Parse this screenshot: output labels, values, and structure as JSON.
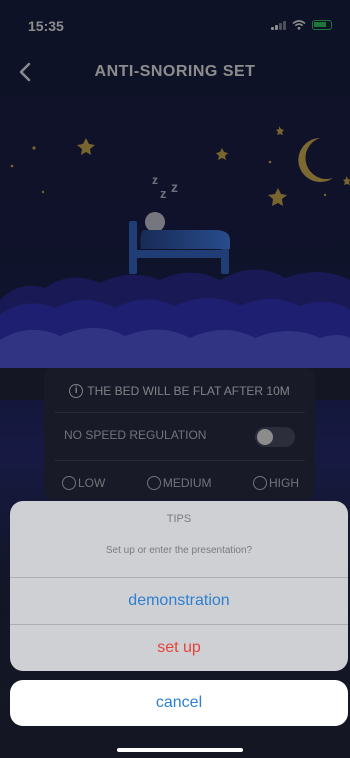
{
  "status_bar": {
    "time": "15:35"
  },
  "header": {
    "title": "ANTI-SNORING SET"
  },
  "illustration": {
    "sleep_text": "z z z"
  },
  "settings": {
    "info_text": "THE BED WILL BE FLAT AFTER 10M",
    "speed_label": "NO SPEED REGULATION",
    "speed_toggle_on": false,
    "options": [
      "LOW",
      "MEDIUM",
      "HIGH"
    ]
  },
  "action_sheet": {
    "title": "TIPS",
    "message": "Set up or enter the presentation?",
    "primary_label": "demonstration",
    "secondary_label": "set up",
    "cancel_label": "cancel"
  },
  "colors": {
    "primary_action": "#2f80d1",
    "destructive_action": "#e4453a",
    "bed_blue": "#3b6fd6",
    "star_gold": "#d9b657"
  }
}
